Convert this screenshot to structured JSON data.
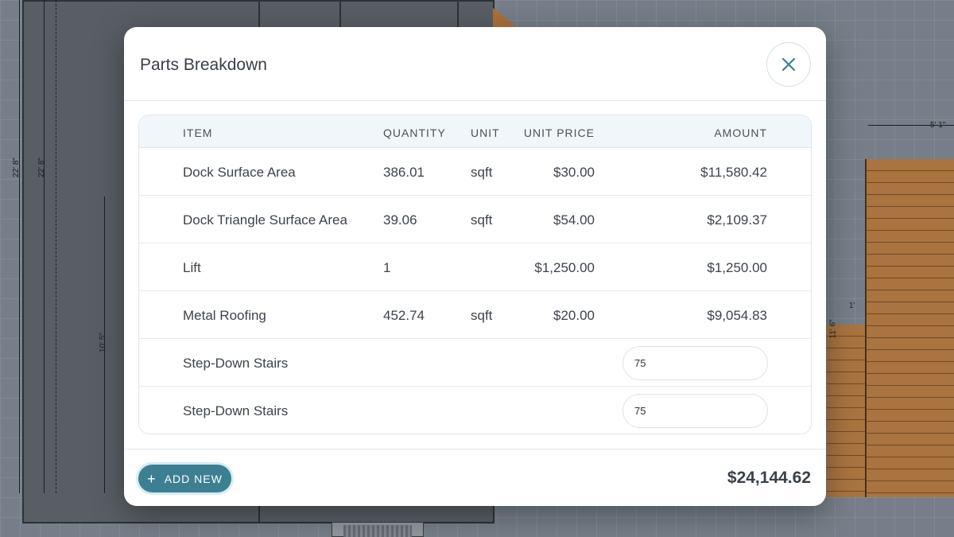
{
  "canvas": {
    "dimensions": [
      "22' 8\"",
      "22' 8\"",
      "10' 5\"",
      "5' 1\"",
      "1'",
      "11' 6\""
    ]
  },
  "modal": {
    "title": "Parts Breakdown",
    "close_icon": "close-icon",
    "table": {
      "columns": [
        "ITEM",
        "QUANTITY",
        "UNIT",
        "UNIT PRICE",
        "AMOUNT"
      ],
      "rows": [
        {
          "item": "Dock Surface Area",
          "quantity": "386.01",
          "unit": "sqft",
          "unit_price": "$30.00",
          "amount": "$11,580.42"
        },
        {
          "item": "Dock Triangle Surface Area",
          "quantity": "39.06",
          "unit": "sqft",
          "unit_price": "$54.00",
          "amount": "$2,109.37"
        },
        {
          "item": "Lift",
          "quantity": "1",
          "unit": "",
          "unit_price": "$1,250.00",
          "amount": "$1,250.00"
        },
        {
          "item": "Metal Roofing",
          "quantity": "452.74",
          "unit": "sqft",
          "unit_price": "$20.00",
          "amount": "$9,054.83"
        },
        {
          "item": "Step-Down Stairs",
          "amount_input": "75"
        },
        {
          "item": "Step-Down Stairs",
          "amount_input": "75"
        }
      ]
    },
    "footer": {
      "add_icon": "plus-icon",
      "add_label": "ADD NEW",
      "total": "$24,144.62"
    }
  },
  "colors": {
    "accent": "#3d7f92",
    "close_icon": "#3d7f92",
    "deck": "#b57a40"
  }
}
